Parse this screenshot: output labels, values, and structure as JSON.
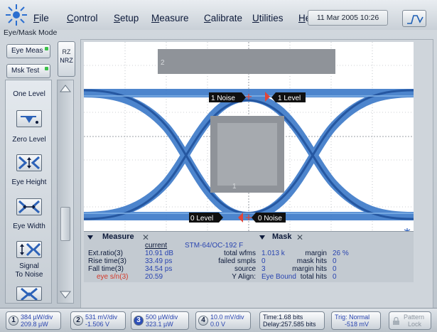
{
  "menu": {
    "items": [
      "File",
      "Control",
      "Setup",
      "Measure",
      "Calibrate",
      "Utilities",
      "Help"
    ],
    "datetime": "11 Mar 2005   10:26",
    "mode": "Eye/Mask Mode"
  },
  "left": {
    "eye_meas": "Eye Meas",
    "msk_test": "Msk Test",
    "rz": "RZ",
    "nrz": "NRZ",
    "tools": [
      "One Level",
      "Zero Level",
      "Eye Height",
      "Eye Width",
      "Signal\nTo Noise"
    ]
  },
  "plot": {
    "mask_top_label": "2",
    "mask_center_label": "1",
    "label_1noise": "1 Noise",
    "label_1level": "1 Level",
    "label_0level": "0 Level",
    "label_0noise": "0 Noise"
  },
  "measure": {
    "title": "Measure",
    "col_current": "current",
    "standard": "STM-64/OC-192 F",
    "mask_title": "Mask",
    "rows": [
      {
        "name": "Ext.ratio(3)",
        "value": "10.91 dB"
      },
      {
        "name": "Rise time(3)",
        "value": "33.49 ps"
      },
      {
        "name": "Fall time(3)",
        "value": "34.54 ps"
      },
      {
        "name": "eye s/n(3)",
        "value": "20.59"
      }
    ],
    "mid": [
      {
        "name": "total wfms",
        "value": "1.013 k"
      },
      {
        "name": "failed smpls",
        "value": "0"
      },
      {
        "name": "source",
        "value": "3"
      },
      {
        "name": "Y Align:",
        "value": "Eye Bound"
      }
    ],
    "right": [
      {
        "name": "margin",
        "value": "26 %"
      },
      {
        "name": "mask hits",
        "value": "0"
      },
      {
        "name": "margin hits",
        "value": "0"
      },
      {
        "name": "total hits",
        "value": "0"
      }
    ]
  },
  "bottom": {
    "channels": [
      {
        "num": "1",
        "line1": "384 µW/div",
        "line2": "209.8 µW"
      },
      {
        "num": "2",
        "line1": "531 mV/div",
        "line2": "-1.506 V"
      },
      {
        "num": "3",
        "line1": "500 µW/div",
        "line2": "323.1 µW"
      },
      {
        "num": "4",
        "line1": "10.0 mV/div",
        "line2": "0.0 V"
      }
    ],
    "time1": "Time:1.68 bits",
    "time2": "Delay:257.585 bits",
    "trig1": "Trig: Normal",
    "trig2": "-518 mV",
    "pattern1": "Pattern",
    "pattern2": "Lock"
  },
  "colors": {
    "eye": "#3a78c8",
    "eye_dark": "#1f4f9a",
    "mask_gray": "#8a8f94"
  }
}
